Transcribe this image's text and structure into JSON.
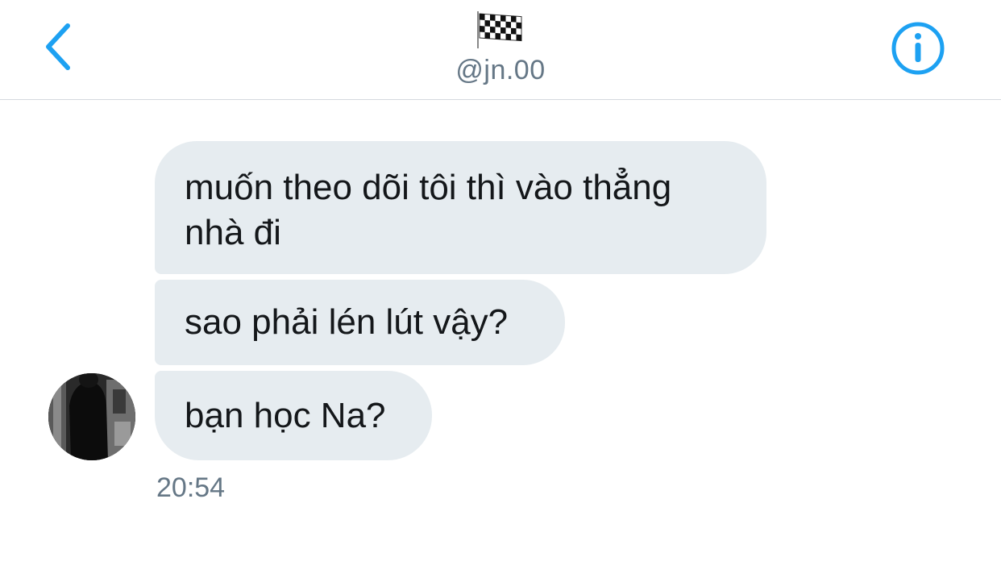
{
  "header": {
    "back_icon": "chevron-left-icon",
    "flag_icon": "checkered-flag-icon",
    "handle": "@jn.00",
    "info_icon": "info-circle-icon",
    "accent_color": "#1da1f2"
  },
  "conversation": {
    "messages": [
      {
        "text": "muốn theo dõi tôi thì vào thẳng nhà đi"
      },
      {
        "text": "sao phải lén lút vậy?"
      },
      {
        "text": "bạn học Na?"
      }
    ],
    "timestamp": "20:54",
    "bubble_color": "#e6ecf0"
  }
}
